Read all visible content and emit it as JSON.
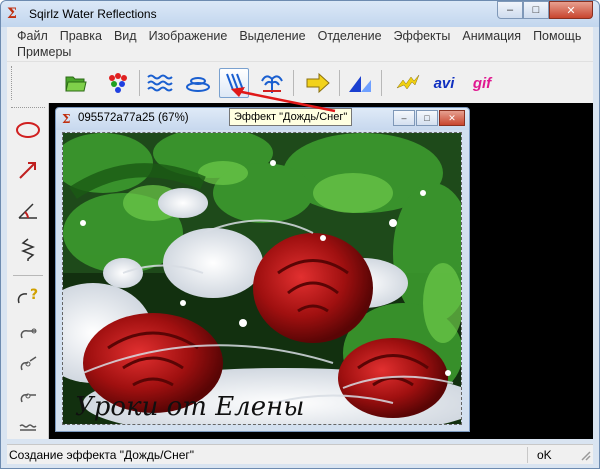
{
  "window": {
    "title": "Sqirlz Water Reflections",
    "minimize": "–",
    "maximize": "□",
    "close": "✕"
  },
  "menu": {
    "row1": [
      "Файл",
      "Правка",
      "Вид",
      "Изображение",
      "Выделение",
      "Отделение",
      "Эффекты",
      "Анимация",
      "Помощь"
    ],
    "row2": [
      "Примеры"
    ]
  },
  "toolbar": {
    "icons": [
      "open-folder-icon",
      "colors-icon",
      "waves-icon",
      "ripple-icon",
      "rain-snow-icon",
      "fountain-icon",
      "arrow-right-icon",
      "reflection-icon",
      "lightning-icon",
      "avi-icon",
      "gif-icon"
    ],
    "avi_label": "avi",
    "gif_label": "gif",
    "tooltip": "Эффект \"Дождь/Снег\""
  },
  "left_toolbar": {
    "icons": [
      "ellipse-icon",
      "arrow-line-icon",
      "angle-icon",
      "zigzag-icon",
      "help-shape-icon",
      "shape-icon-1",
      "shape-icon-2",
      "shape-icon-3",
      "shape-icon-4"
    ]
  },
  "document": {
    "title": "095572a77a25  (67%)",
    "minimize": "–",
    "maximize": "□",
    "close": "✕",
    "image_caption": "Уроки от Елены"
  },
  "status": {
    "message": "Создание эффекта \"Дождь/Снег\"",
    "right": "oK"
  },
  "colors": {
    "accent_red": "#e01818",
    "workspace": "#000000",
    "rose": "#a81010",
    "foliage": "#2f8a2a"
  }
}
